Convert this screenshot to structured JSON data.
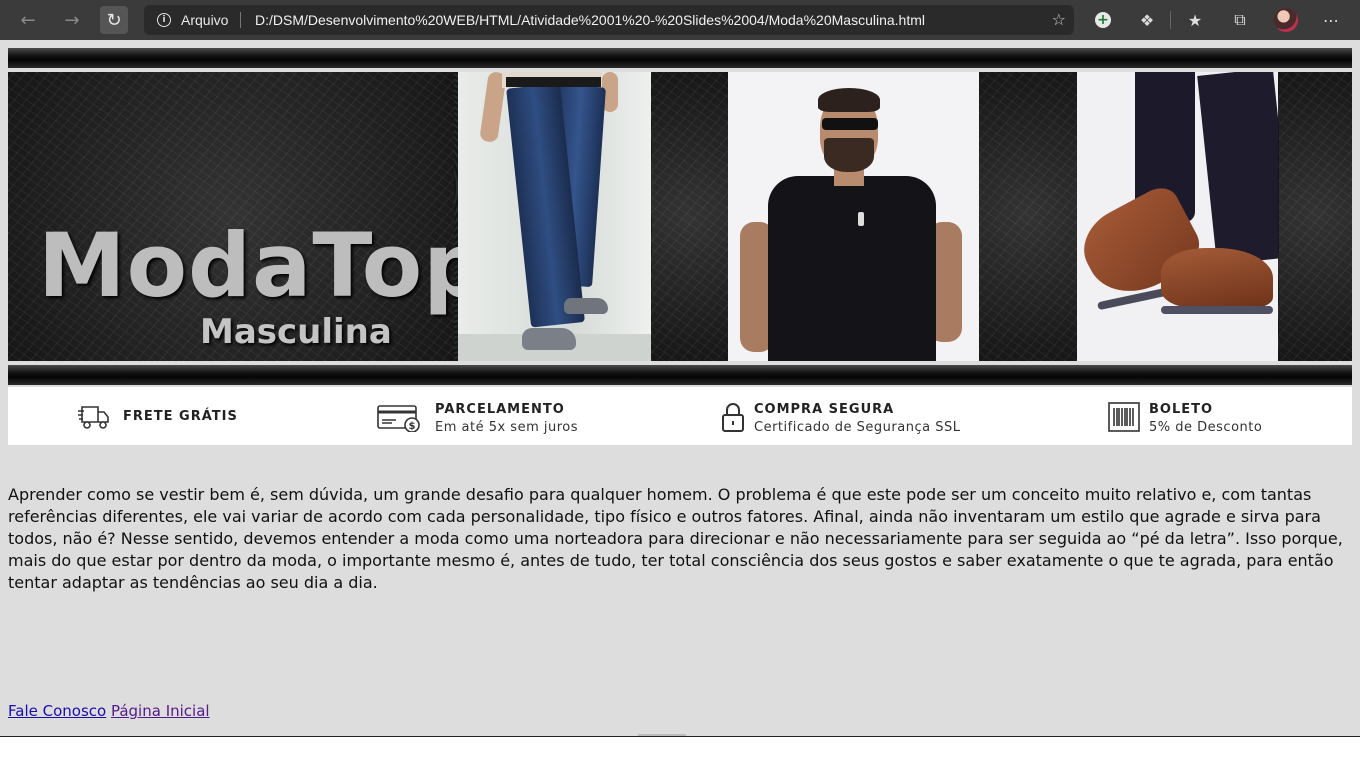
{
  "browser": {
    "protocol_label": "Arquivo",
    "url": "D:/DSM/Desenvolvimento%20WEB/HTML/Atividade%2001%20-%20Slides%2004/Moda%20Masculina.html"
  },
  "banner": {
    "brand": "ModaTop",
    "brand_sub": "Masculina"
  },
  "features": [
    {
      "icon": "truck-icon",
      "title": "FRETE GRÁTIS",
      "subtitle": ""
    },
    {
      "icon": "card-icon",
      "title": "PARCELAMENTO",
      "subtitle": "Em até 5x sem juros"
    },
    {
      "icon": "lock-icon",
      "title": "COMPRA SEGURA",
      "subtitle": "Certificado de Segurança SSL"
    },
    {
      "icon": "barcode-icon",
      "title": "BOLETO",
      "subtitle": "5% de Desconto"
    }
  ],
  "content": {
    "paragraph": "Aprender como se vestir bem é, sem dúvida, um grande desafio para qualquer homem. O problema é que este pode ser um conceito muito relativo e, com tantas referências diferentes, ele vai variar de acordo com cada personalidade, tipo físico e outros fatores. Afinal, ainda não inventaram um estilo que agrade e sirva para todos, não é? Nesse sentido, devemos entender a moda como uma norteadora para direcionar e não necessariamente para ser seguida ao “pé da letra”. Isso porque, mais do que estar por dentro da moda, o importante mesmo é, antes de tudo, ter total consciência dos seus gostos e saber exatamente o que te agrada, para então tentar adaptar as tendências ao seu dia a dia."
  },
  "links": {
    "contact": "Fale Conosco",
    "home": "Página Inicial"
  }
}
